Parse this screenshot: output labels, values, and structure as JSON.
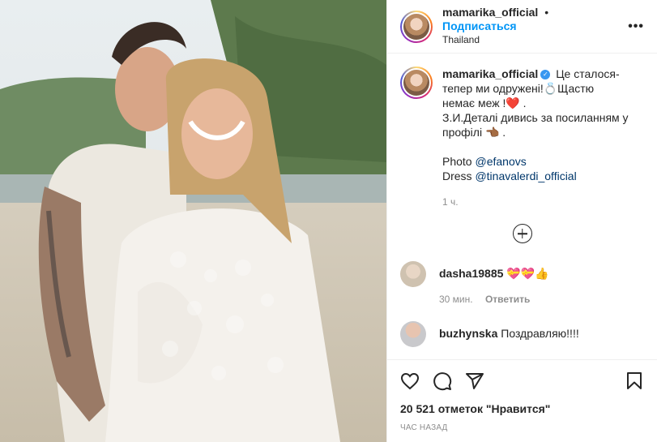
{
  "header": {
    "username": "mamarika_official",
    "separator": "•",
    "follow_label": "Подписаться",
    "location": "Thailand",
    "more_label": "•••"
  },
  "caption": {
    "username": "mamarika_official",
    "verified": "✓",
    "line1": "Це сталося-тепер ми одружені!💍Щастю немає меж !❤️ .",
    "line2": "З.И.Деталі дивись за посиланням у профілі 👈🏾 .",
    "photo_label": "Photo",
    "photo_link": "@efanovs",
    "dress_label": "Dress",
    "dress_link": "@tinavalerdi_official",
    "time": "1 ч."
  },
  "comments": [
    {
      "username": "dasha19885",
      "text": "💝💝👍",
      "time": "30 мин.",
      "reply_label": "Ответить"
    },
    {
      "username": "buzhynska",
      "text": "Поздравляю!!!!"
    }
  ],
  "actions": {
    "like_icon": "heart-icon",
    "comment_icon": "comment-icon",
    "share_icon": "send-icon",
    "save_icon": "bookmark-icon"
  },
  "likes_text": "20 521 отметок \"Нравится\"",
  "posted_time": "час назад",
  "colors": {
    "follow": "#0095f6",
    "link": "#00376b",
    "muted": "#8e8e8e"
  }
}
